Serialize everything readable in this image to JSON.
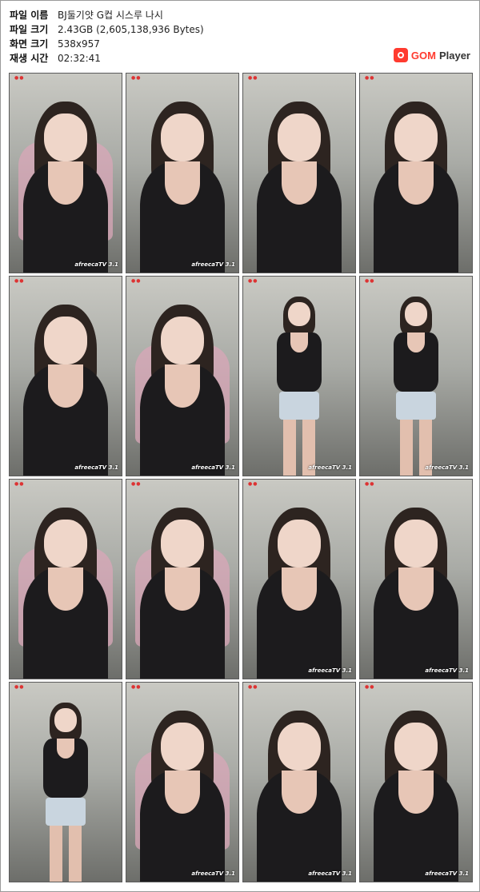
{
  "info": {
    "rows": [
      {
        "key": "파일 이름",
        "value": "BJ둘기얏 G컵 시스루 나시"
      },
      {
        "key": "파일 크기",
        "value": "2.43GB (2,605,138,936 Bytes)"
      },
      {
        "key": "화면 크기",
        "value": "538x957"
      },
      {
        "key": "재생 시간",
        "value": "02:32:41"
      }
    ]
  },
  "brand": {
    "gom": "GOM",
    "player": " Player"
  },
  "thumbnails": [
    {
      "watermark": "afreecaTV 3.1"
    },
    {
      "watermark": "afreecaTV 3.1"
    },
    {
      "watermark": ""
    },
    {
      "watermark": ""
    },
    {
      "watermark": "afreecaTV 3.1"
    },
    {
      "watermark": "afreecaTV 3.1"
    },
    {
      "watermark": "afreecaTV 3.1"
    },
    {
      "watermark": "afreecaTV 3.1"
    },
    {
      "watermark": ""
    },
    {
      "watermark": ""
    },
    {
      "watermark": "afreecaTV 3.1"
    },
    {
      "watermark": "afreecaTV 3.1"
    },
    {
      "watermark": ""
    },
    {
      "watermark": "afreecaTV 3.1"
    },
    {
      "watermark": "afreecaTV 3.1"
    },
    {
      "watermark": "afreecaTV 3.1"
    }
  ],
  "colors": {
    "brand_accent": "#ff3b2f"
  }
}
